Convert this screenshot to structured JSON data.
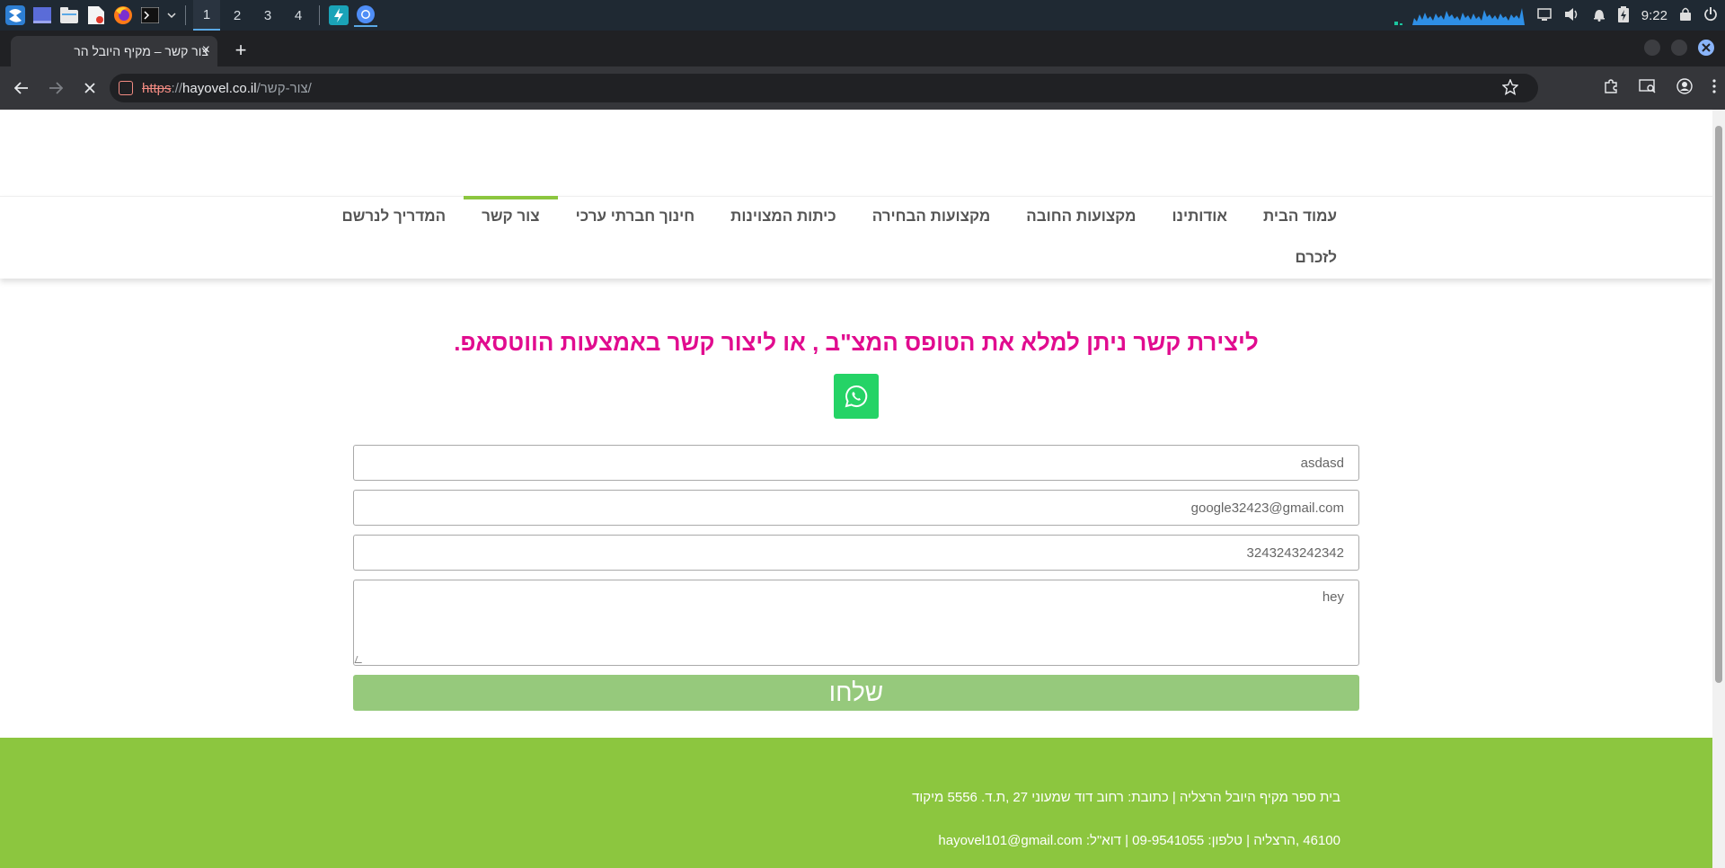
{
  "taskbar": {
    "workspaces": [
      "1",
      "2",
      "3",
      "4"
    ],
    "active_workspace": "1",
    "clock": "9:22"
  },
  "browser": {
    "tab_title": "צור קשר – מקיף היובל הר",
    "tab_close": "×",
    "new_tab": "+",
    "url_scheme": "https",
    "url_sep": "://",
    "url_host": "hayovel.co.il",
    "url_path": "/צור-קשר/"
  },
  "nav": {
    "row1": [
      {
        "label": "עמוד הבית",
        "active": false
      },
      {
        "label": "אודותינו",
        "active": false
      },
      {
        "label": "מקצועות החובה",
        "active": false
      },
      {
        "label": "מקצועות הבחירה",
        "active": false
      },
      {
        "label": "כיתות המצוינות",
        "active": false
      },
      {
        "label": "חינוך חברתי ערכי",
        "active": false
      },
      {
        "label": "צור קשר",
        "active": true
      },
      {
        "label": "המדריך לנרשם",
        "active": false
      }
    ],
    "row2": [
      {
        "label": "לזכרם",
        "active": false
      }
    ],
    "accent": "#8cc63f"
  },
  "contact": {
    "intro": "ליצירת קשר ניתן למלא את הטופס המצ\"ב , או ליצור קשר באמצעות הווטסאפ.",
    "intro_color": "#e10c8f",
    "whatsapp_color": "#25d366",
    "fields": {
      "name": "asdasd",
      "email": "google32423@gmail.com",
      "phone": "3243243242342",
      "message": "hey"
    },
    "submit_label": "שלחו"
  },
  "footer": {
    "line1": "בית ספר מקיף היובל הרצליה | כתובת: רחוב דוד שמעוני 27 ,ת.ד. 5556 מיקוד",
    "line2": "46100 ,הרצליה | טלפון: 09-9541055  | דוא\"ל: hayovel101@gmail.com",
    "bg_color": "#8cc63f"
  }
}
